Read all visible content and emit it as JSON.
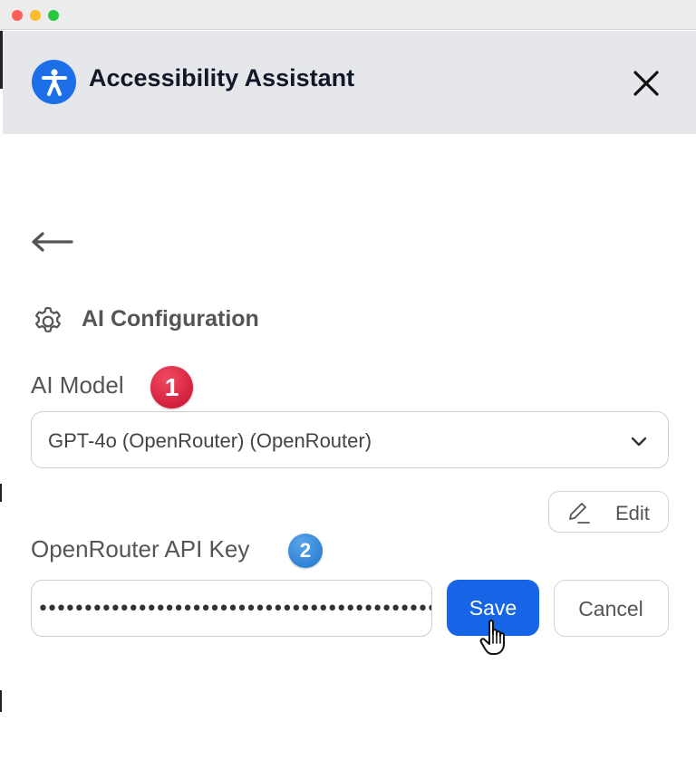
{
  "window": {
    "controls": [
      "close",
      "minimize",
      "maximize"
    ]
  },
  "header": {
    "title": "Accessibility Assistant",
    "logo_icon": "accessibility-icon",
    "close_icon": "close-icon",
    "background": "#e5e7eb",
    "accent": "#1d6fe8"
  },
  "nav": {
    "back_icon": "arrow-left-icon"
  },
  "section": {
    "icon": "gear-icon",
    "title": "AI Configuration"
  },
  "model": {
    "label": "AI Model",
    "badge": "1",
    "selected": "GPT-4o (OpenRouter) (OpenRouter)",
    "edit_label": "Edit"
  },
  "api_key": {
    "label": "OpenRouter API Key",
    "badge": "2",
    "masked_value": "••••••••••••••••••••••••••••••••••••••••••••••••••",
    "save_label": "Save",
    "cancel_label": "Cancel",
    "save_color": "#1565e6"
  },
  "cursor": {
    "icon": "hand-pointer-icon"
  }
}
